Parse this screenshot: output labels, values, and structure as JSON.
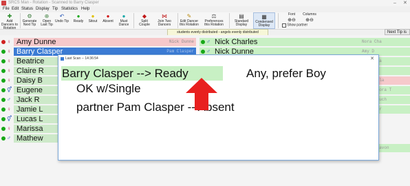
{
  "window": {
    "title": "SRCS Man - Rotation - Scanned to Barry Clasper"
  },
  "menu": [
    "File",
    "Edit",
    "Status",
    "Display",
    "Tip",
    "Statistics",
    "Help"
  ],
  "toolbar": {
    "add_dancers": "Add Dancers to Rotation",
    "generate": "Generate Next Tip",
    "open": "Open Last Tip",
    "undo": "Undo Tip",
    "ready": "Ready",
    "sitout": "Sitout",
    "absent": "Absent",
    "must_dance": "Must Dance",
    "split_couple": "Split Couple",
    "join_two": "Join Two Dancers",
    "edit_dancer": "Edit Dancer this Rotation",
    "preferences": "Preferences this Rotation",
    "standard_display": "Standard Display",
    "condensed_display": "Condensed Display",
    "font": "Font",
    "columns": "Columns",
    "show_partner": "Show partner"
  },
  "status_strip": "students evenly distributed - angels evenly distributed",
  "next_tip_header": "Next Tip is",
  "left_rows": [
    {
      "name": "Amy Dunne",
      "ghost": "Nick Dunne",
      "style": "pink",
      "sym": "♀"
    },
    {
      "name": "Barry Clasper",
      "ghost": "Pam Clasper",
      "style": "sel",
      "sym": "♀"
    },
    {
      "name": "Beatrice",
      "ghost": "",
      "style": "green",
      "sym": "♀"
    },
    {
      "name": "Claire R",
      "ghost": "",
      "style": "green",
      "sym": "♀"
    },
    {
      "name": "Daisy B",
      "ghost": "",
      "style": "green",
      "sym": "♀"
    },
    {
      "name": "Eugene",
      "ghost": "",
      "style": "green",
      "sym": "⚥"
    },
    {
      "name": "Jack R",
      "ghost": "",
      "style": "green",
      "sym": "♂"
    },
    {
      "name": "Jamie L",
      "ghost": "",
      "style": "green",
      "sym": "♀"
    },
    {
      "name": "Lucas L",
      "ghost": "",
      "style": "green",
      "sym": "⚥"
    },
    {
      "name": "Marissa",
      "ghost": "",
      "style": "green",
      "sym": "♀"
    },
    {
      "name": "Mathew",
      "ghost": "",
      "style": "green",
      "sym": "♂"
    }
  ],
  "right_rows": [
    {
      "name": "Nick Charles",
      "sym": "♂"
    },
    {
      "name": "Nick Dunne",
      "sym": "♂"
    }
  ],
  "far_right": [
    "Nora Cha",
    "Amy D",
    "Nick Cha",
    "Simon L",
    "Barry Cla",
    "Nymphadora T",
    "Daisy Buch",
    "Jamie Fr",
    "",
    "",
    "Lucas Davon"
  ],
  "dialog": {
    "title": "Last Scan -- 14:36:54",
    "line1": "Barry Clasper  -->  Ready",
    "preference": "Any, prefer Boy",
    "line2": "OK w/Single",
    "line3": "partner Pam Clasper -- Absent"
  },
  "colors": {
    "highlight": "#c8f0c4",
    "selected": "#3b7bd4",
    "pink": "#f6c9cb",
    "arrow": "#e8201f"
  }
}
